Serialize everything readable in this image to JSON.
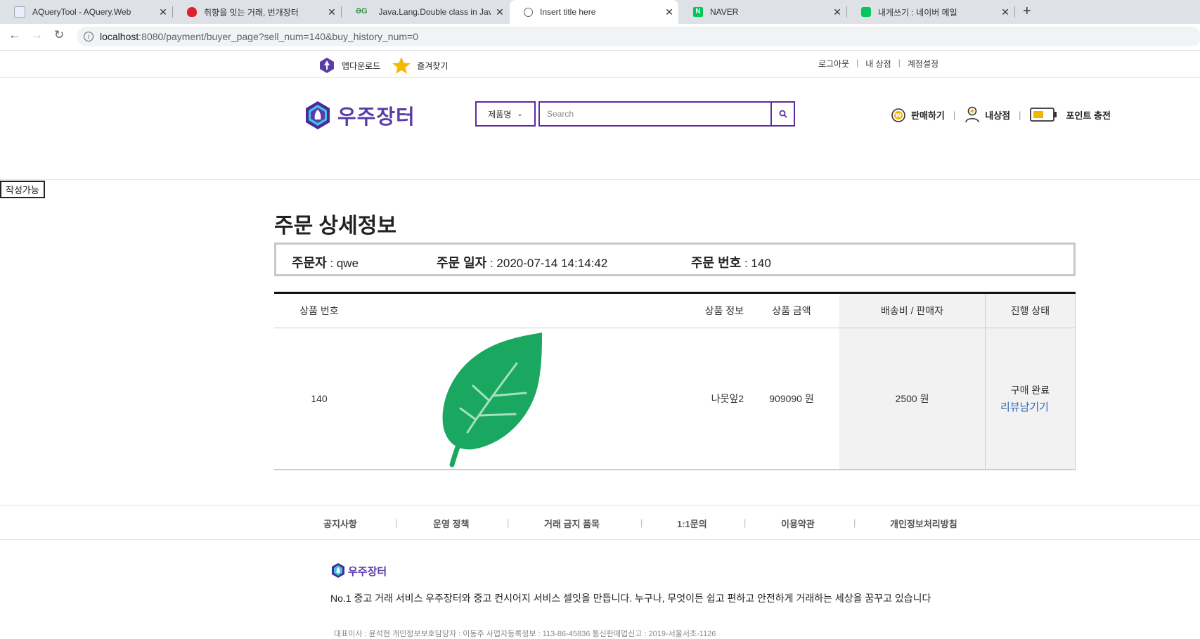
{
  "browser": {
    "tabs": [
      {
        "title": "AQueryTool - AQuery.Web",
        "active": false
      },
      {
        "title": "취향을 잇는 거래, 번개장터",
        "active": false
      },
      {
        "title": "Java.Lang.Double class in Java - ",
        "active": false
      },
      {
        "title": "Insert title here",
        "active": true
      },
      {
        "title": "NAVER",
        "active": false
      },
      {
        "title": "내게쓰기 : 네이버 메일",
        "active": false
      }
    ],
    "url_host": "localhost",
    "url_path": ":8080/payment/buyer_page?sell_num=140&buy_history_num=0"
  },
  "topbar": {
    "app_download": "앱다운로드",
    "favorites": "즐겨찾기",
    "logout": "로그아웃",
    "my_shop": "내 상점",
    "account_settings": "계정설정",
    "separator": "|"
  },
  "header": {
    "logo_text": "우주장터",
    "search_category": "제품명",
    "search_placeholder": "Search",
    "sell": "판매하기",
    "my_store": "내상점",
    "point_charge": "포인트 충전",
    "separator": "|"
  },
  "writable_label": "작성가능",
  "order": {
    "heading": "주문 상세정보",
    "orderer_label": "주문자",
    "orderer_value": " : qwe",
    "date_label": "주문 일자",
    "date_value": " : 2020-07-14 14:14:42",
    "number_label": "주문 번호",
    "number_value": " : 140"
  },
  "table": {
    "headers": {
      "product_no": "상품 번호",
      "product_info": "상품 정보",
      "price": "상품 금액",
      "shipping_seller": "배송비 / 판매자",
      "status": "진행 상태"
    },
    "row": {
      "product_no": "140",
      "product_name": "나뭇잎2",
      "price": "909090 원",
      "shipping": "2500 원",
      "status": "구매 완료",
      "review_link": "리뷰남기기"
    }
  },
  "footer": {
    "nav": [
      "공지사항",
      "운영 정책",
      "거래 금지 품목",
      "1:1문의",
      "이용약관",
      "개인정보처리방침"
    ],
    "separator": "|",
    "logo_text": "우주장터",
    "description": "No.1 중고 거래 서비스 우주장터와 중고 컨시어지 서비스 셀잇을 만듭니다. 누구나, 무엇이든 쉽고 편하고 안전하게 거래하는 세상을 꿈꾸고 있습니다",
    "company_info": "대표이사 : 윤석현 개인정보보호담당자 : 이동주 사업자등록정보 : 113-86-45836 통신판매업신고 : 2019-서울서초-1126"
  },
  "colors": {
    "brand": "#5a3ca8",
    "search_border": "#5a2ca0",
    "leaf": "#1aa760",
    "link": "#2a6ab8"
  }
}
